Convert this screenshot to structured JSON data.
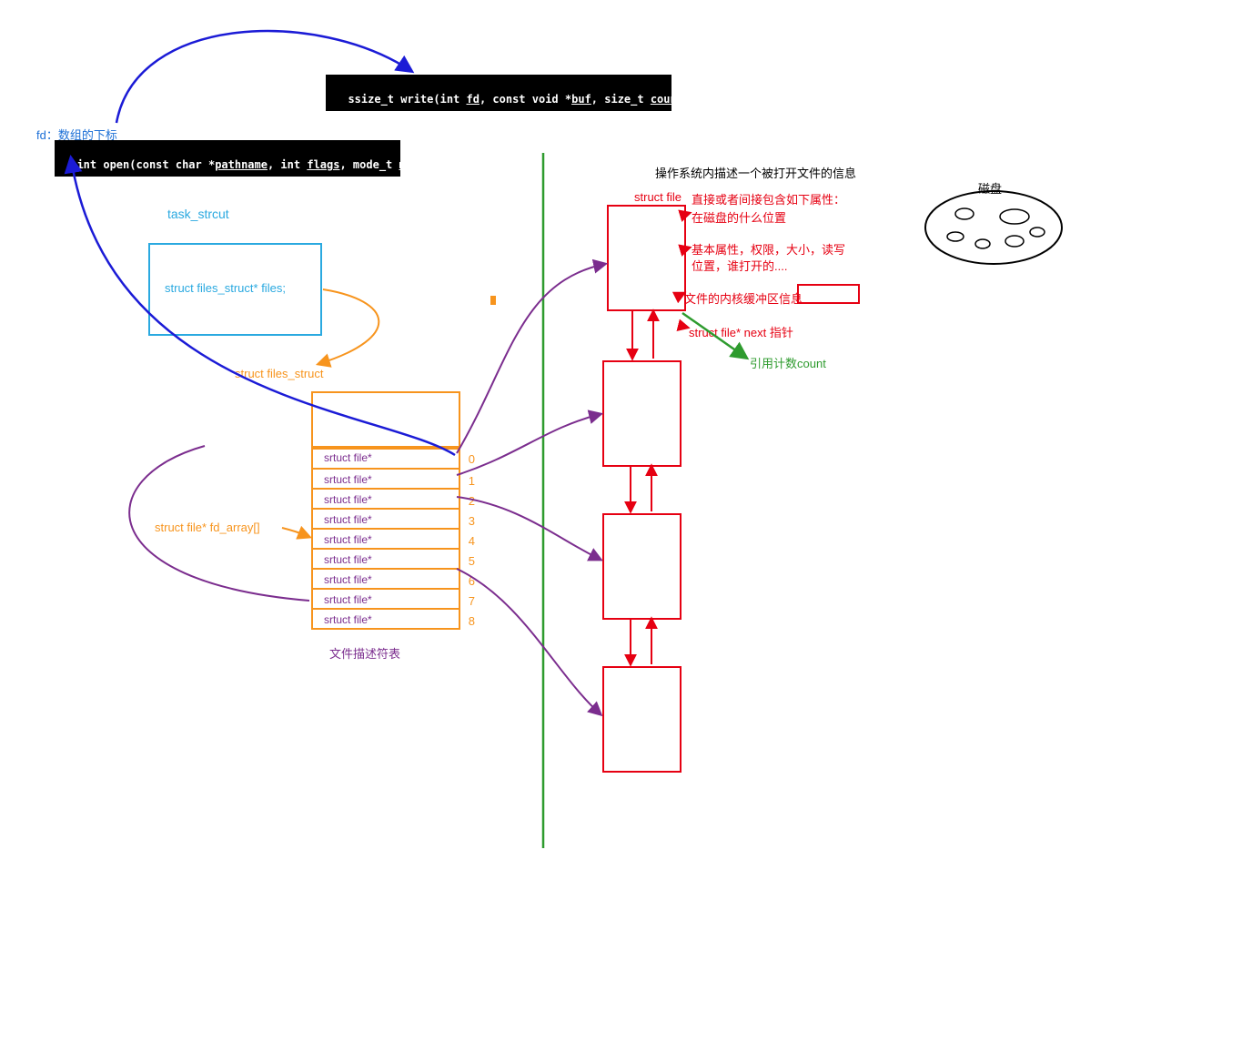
{
  "code": {
    "write": "ssize_t write(int fd, const void *buf, size_t count);",
    "open": "int open(const char *pathname, int flags, mode_t mode);"
  },
  "labels": {
    "fd_note": "fd：数组的下标",
    "task_struct": "task_strcut",
    "files_field": "struct files_struct* files;",
    "files_struct": "struct files_struct",
    "fd_array": "struct file* fd_array[]",
    "fd_table_caption": "文件描述符表",
    "os_describe": "操作系统内描述一个被打开文件的信息",
    "struct_file": "struct file",
    "attrs_header": "直接或者间接包含如下属性：",
    "attr_disk_pos": "在磁盘的什么位置",
    "attr_basic": "基本属性，权限，大小，读写位置，谁打开的....",
    "attr_kernel_buf": "文件的内核缓冲区信息",
    "attr_next_ptr": "struct file* next 指针",
    "ref_count": "引用计数count",
    "disk": "磁盘"
  },
  "fd_rows": [
    {
      "label": "srtuct file*",
      "index": "0"
    },
    {
      "label": "srtuct file*",
      "index": "1"
    },
    {
      "label": "srtuct file*",
      "index": "2"
    },
    {
      "label": "srtuct file*",
      "index": "3"
    },
    {
      "label": "srtuct file*",
      "index": "4"
    },
    {
      "label": "srtuct file*",
      "index": "5"
    },
    {
      "label": "srtuct file*",
      "index": "6"
    },
    {
      "label": "srtuct file*",
      "index": "7"
    },
    {
      "label": "srtuct file*",
      "index": "8"
    }
  ],
  "colors": {
    "blue": "#1b1bd6",
    "cyan": "#2aa9e0",
    "orange": "#f7941d",
    "purple": "#7b2d8e",
    "red": "#e60012",
    "green": "#2e9b2e"
  }
}
